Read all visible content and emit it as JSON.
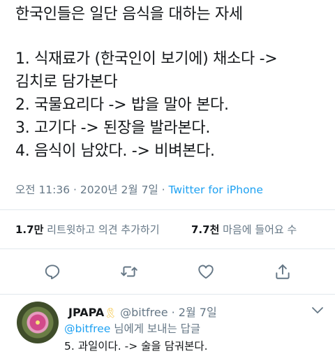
{
  "tweet": {
    "title_line": "한국인들은 일단 음식을 대하는 자세",
    "lines": [
      "1. 식재료가 (한국인이 보기에) 채소다 ->",
      "김치로 담가본다",
      "2. 국물요리다 -> 밥을 말아 본다.",
      "3. 고기다 -> 된장을 발라본다.",
      "4. 음식이 남았다. -> 비벼본다."
    ],
    "timestamp": "오전 11:36 · 2020년 2월 7일 · ",
    "source": "Twitter for iPhone"
  },
  "stats": {
    "retweets_count": "1.7만",
    "retweets_label": "리트윗하고 의견 추가하기",
    "likes_count": "7.7천",
    "likes_label": "마음에 들어요 수"
  },
  "actions": [
    {
      "icon": "reply-icon"
    },
    {
      "icon": "retweet-icon"
    },
    {
      "icon": "like-icon"
    },
    {
      "icon": "share-icon"
    }
  ],
  "reply": {
    "name": "JPAPA",
    "ribbon": "🎗",
    "handle": "@bitfree · 2월 7일",
    "mention": "@bitfree",
    "reply_suffix": " 님에게 보내는 답글",
    "text": "5. 과일이다. -> 술을 담궈본다."
  },
  "colors": {
    "text": "#14171a",
    "secondary": "#657786",
    "accent": "#1da1f2",
    "divider": "#e1e8ed"
  }
}
